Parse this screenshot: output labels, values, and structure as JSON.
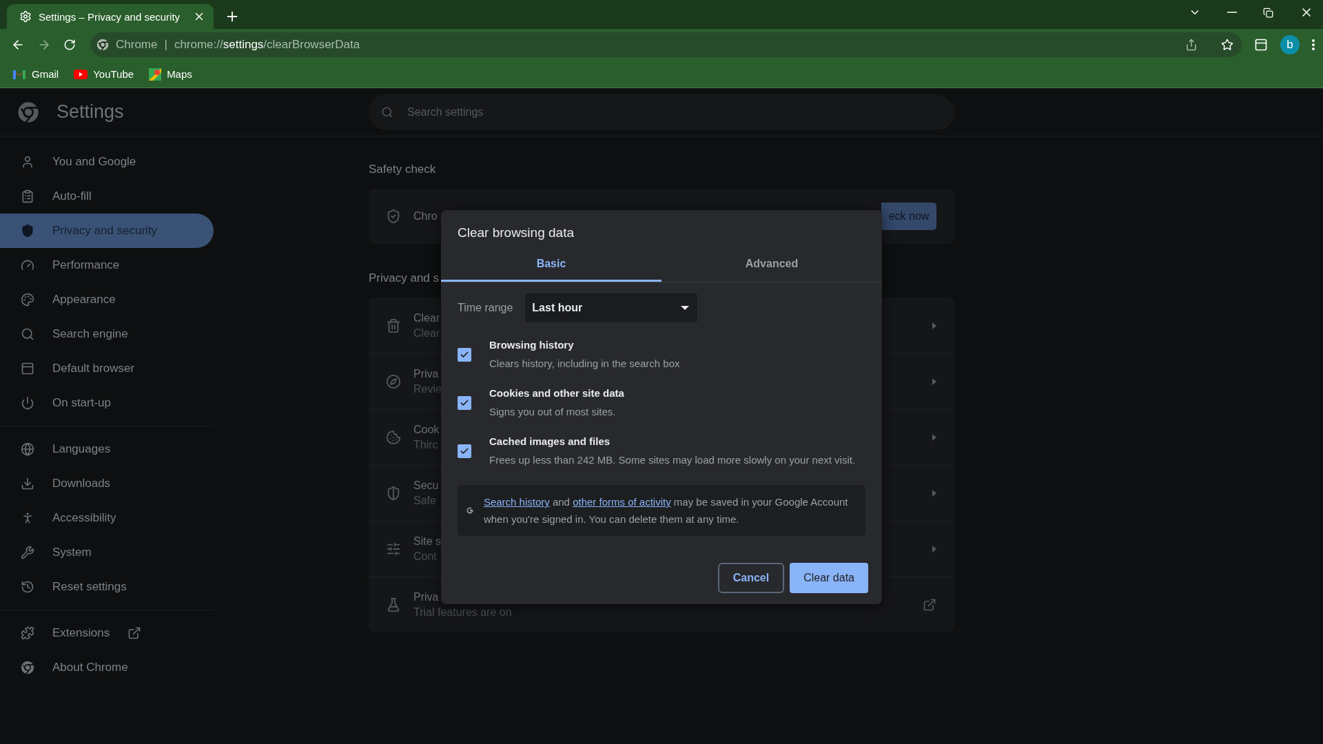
{
  "browser": {
    "tab": {
      "title": "Settings – Privacy and security",
      "selected": true
    },
    "address": {
      "scheme_label": "Chrome",
      "separator": "|",
      "url_prefix": "chrome://",
      "url_host": "settings",
      "url_path": "/clearBrowserData"
    },
    "avatar": "b",
    "bookmarks": [
      "Gmail",
      "YouTube",
      "Maps"
    ]
  },
  "settings": {
    "title": "Settings",
    "search": {
      "placeholder": "Search settings"
    },
    "nav_groups": [
      [
        {
          "label": "You and Google",
          "selected": false
        },
        {
          "label": "Auto-fill",
          "selected": false
        },
        {
          "label": "Privacy and security",
          "selected": true
        },
        {
          "label": "Performance",
          "selected": false
        },
        {
          "label": "Appearance",
          "selected": false
        },
        {
          "label": "Search engine",
          "selected": false
        },
        {
          "label": "Default browser",
          "selected": false
        },
        {
          "label": "On start-up",
          "selected": false
        }
      ],
      [
        {
          "label": "Languages",
          "selected": false
        },
        {
          "label": "Downloads",
          "selected": false
        },
        {
          "label": "Accessibility",
          "selected": false
        },
        {
          "label": "System",
          "selected": false
        },
        {
          "label": "Reset settings",
          "selected": false
        }
      ],
      [
        {
          "label": "Extensions",
          "selected": false,
          "external": true
        },
        {
          "label": "About Chrome",
          "selected": false,
          "external": false
        }
      ]
    ],
    "safety_check": {
      "heading": "Safety check",
      "card_text": "Chro",
      "button": "eck now"
    },
    "privacy": {
      "heading": "Privacy and s",
      "rows": [
        {
          "title": "Clear",
          "subtitle": "Clear",
          "kind": "submenu"
        },
        {
          "title": "Priva",
          "subtitle": "Revie",
          "kind": "submenu"
        },
        {
          "title": "Cook",
          "subtitle": "Thirc",
          "kind": "submenu"
        },
        {
          "title": "Secu",
          "subtitle": "Safe",
          "kind": "submenu"
        },
        {
          "title": "Site s",
          "subtitle": "Cont",
          "kind": "submenu"
        },
        {
          "title": "Priva",
          "subtitle": "Trial features are on",
          "kind": "external"
        }
      ]
    }
  },
  "dialog": {
    "title": "Clear browsing data",
    "tabs": [
      {
        "label": "Basic",
        "selected": true
      },
      {
        "label": "Advanced",
        "selected": false
      }
    ],
    "time_range": {
      "label": "Time range",
      "value": "Last hour"
    },
    "options": [
      {
        "title": "Browsing history",
        "description": "Clears history, including in the search box",
        "checked": true
      },
      {
        "title": "Cookies and other site data",
        "description": "Signs you out of most sites.",
        "checked": true
      },
      {
        "title": "Cached images and files",
        "description": "Frees up less than 242 MB. Some sites may load more slowly on your next visit.",
        "checked": true
      }
    ],
    "info": [
      {
        "text": "Search history",
        "link": true
      },
      {
        "text": " and ",
        "link": false
      },
      {
        "text": "other forms of activity",
        "link": true
      },
      {
        "text": " may be saved in your Google Account when you're signed in. You can delete them at any time.",
        "link": false
      }
    ],
    "buttons": {
      "cancel": "Cancel",
      "confirm": "Clear data"
    }
  }
}
